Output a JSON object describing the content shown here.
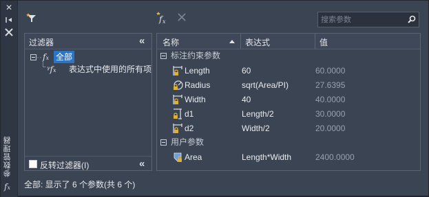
{
  "palette_title": "参数管理器",
  "toolbar": {
    "filter_icon": "funnel-star-icon",
    "create_param_icon": "fx-star-icon",
    "delete_icon": "close-x-icon",
    "search_placeholder": "搜索参数"
  },
  "filter_panel": {
    "header": "过滤器",
    "tree": [
      {
        "label": "全部",
        "selected": true
      },
      {
        "label": "表达式中使用的所有项",
        "selected": false
      }
    ],
    "invert_label": "反转过滤器(I)"
  },
  "grid": {
    "columns": [
      "名称",
      "表达式",
      "值"
    ],
    "groups": [
      {
        "name": "标注约束参数",
        "rows": [
          {
            "name": "Length",
            "expression": "60",
            "value": "60.0000",
            "icon": "linear-lock-icon"
          },
          {
            "name": "Radius",
            "expression": "sqrt(Area/PI)",
            "value": "27.6395",
            "icon": "radius-lock-icon"
          },
          {
            "name": "Width",
            "expression": "40",
            "value": "40.0000",
            "icon": "linear-lock-icon"
          },
          {
            "name": "d1",
            "expression": "Length/2",
            "value": "30.0000",
            "icon": "vertical-lock-icon"
          },
          {
            "name": "d2",
            "expression": "Width/2",
            "value": "20.0000",
            "icon": "linear-lock-icon"
          }
        ]
      },
      {
        "name": "用户参数",
        "rows": [
          {
            "name": "Area",
            "expression": "Length*Width",
            "value": "2400.0000",
            "icon": "user-param-icon"
          }
        ]
      }
    ]
  },
  "status": "全部: 显示了 6 个参数(共 6 个)",
  "colors": {
    "selection": "#2d75c4",
    "panel": "#3b4453",
    "lock": "#e0b030"
  }
}
